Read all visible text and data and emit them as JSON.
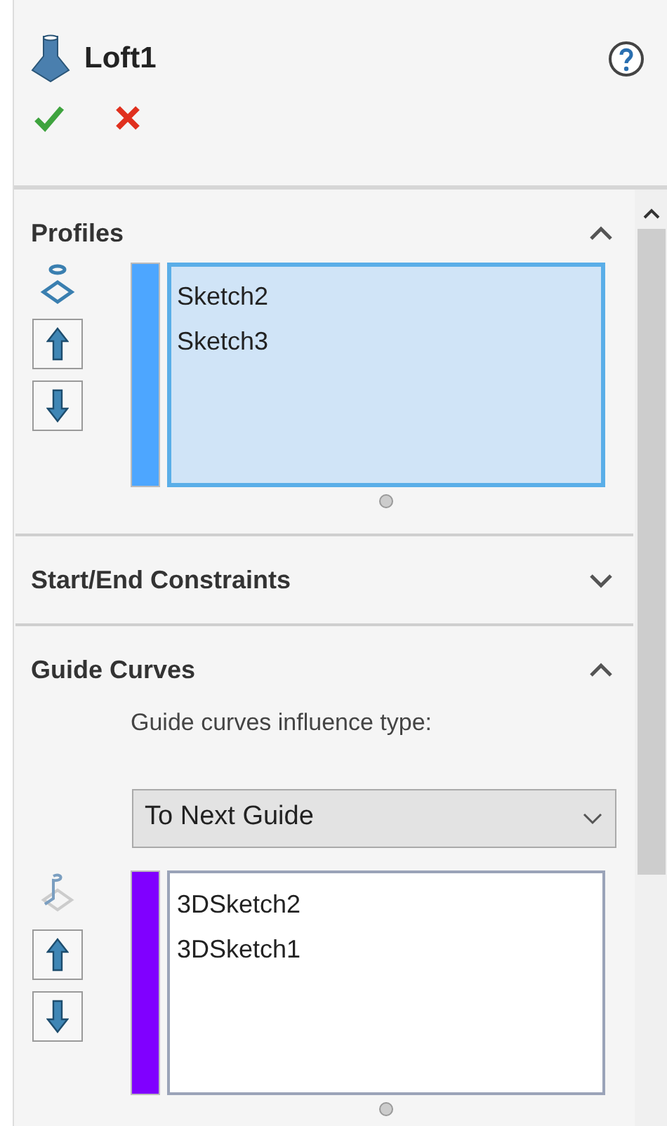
{
  "header": {
    "title": "Loft1"
  },
  "sections": [
    {
      "kind": "profiles",
      "title": "Profiles",
      "expanded": true,
      "list": {
        "color": "#4da6ff",
        "selected": true,
        "items": [
          "Sketch2",
          "Sketch3"
        ]
      }
    },
    {
      "kind": "constraints",
      "title": "Start/End Constraints",
      "expanded": false
    },
    {
      "kind": "guides",
      "title": "Guide Curves",
      "expanded": true,
      "influence_label": "Guide curves influence type:",
      "dropdown": {
        "value": "To Next Guide"
      },
      "list": {
        "color": "#8000ff",
        "selected": false,
        "items": [
          "3DSketch2",
          "3DSketch1"
        ]
      }
    }
  ]
}
